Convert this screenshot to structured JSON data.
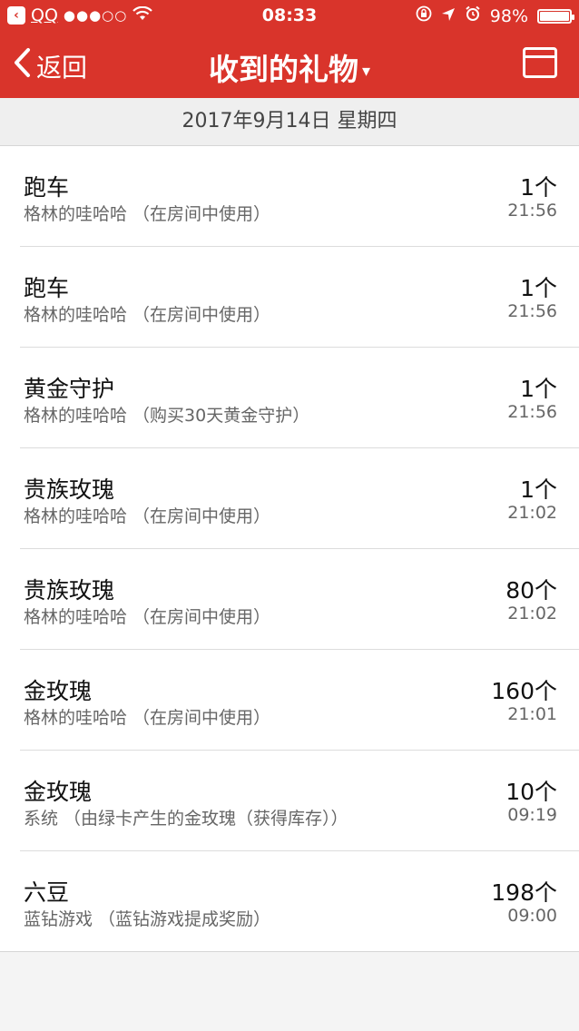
{
  "status_bar": {
    "carrier": "QQ",
    "signal": "●●●○○",
    "time": "08:33",
    "battery": "98%",
    "battery_level": 0.98
  },
  "nav": {
    "back_label": "返回",
    "title": "收到的礼物",
    "title_caret": "▾",
    "accent_color": "#d9342b"
  },
  "date_header": "2017年9月14日 星期四",
  "gifts": [
    {
      "name": "跑车",
      "detail": "格林的哇哈哈 （在房间中使用）",
      "qty": "1个",
      "time": "21:56"
    },
    {
      "name": "跑车",
      "detail": "格林的哇哈哈 （在房间中使用）",
      "qty": "1个",
      "time": "21:56"
    },
    {
      "name": "黄金守护",
      "detail": "格林的哇哈哈 （购买30天黄金守护）",
      "qty": "1个",
      "time": "21:56"
    },
    {
      "name": "贵族玫瑰",
      "detail": "格林的哇哈哈 （在房间中使用）",
      "qty": "1个",
      "time": "21:02"
    },
    {
      "name": "贵族玫瑰",
      "detail": "格林的哇哈哈 （在房间中使用）",
      "qty": "80个",
      "time": "21:02"
    },
    {
      "name": "金玫瑰",
      "detail": "格林的哇哈哈 （在房间中使用）",
      "qty": "160个",
      "time": "21:01"
    },
    {
      "name": "金玫瑰",
      "detail": "系统 （由绿卡产生的金玫瑰（获得库存））",
      "qty": "10个",
      "time": "09:19"
    },
    {
      "name": "六豆",
      "detail": "蓝钻游戏 （蓝钻游戏提成奖励）",
      "qty": "198个",
      "time": "09:00"
    }
  ]
}
